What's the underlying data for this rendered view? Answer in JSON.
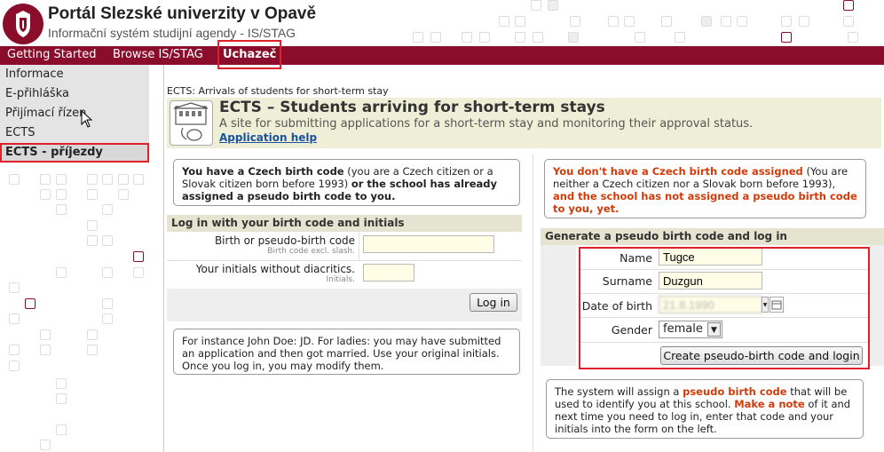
{
  "header": {
    "title": "Portál Slezské univerzity v Opavě",
    "subtitle": "Informační systém studijní agendy - IS/STAG"
  },
  "menubar": {
    "items": [
      "Getting Started",
      "Browse IS/STAG",
      "Uchazeč"
    ]
  },
  "sidebar": {
    "items": [
      "Informace",
      "E-přihláška",
      "Přijímací řízen",
      "ECTS",
      "ECTS - příjezdy"
    ],
    "active_index": 4
  },
  "breadcrumb": "ECTS: Arrivals of students for short-term stay",
  "banner": {
    "title": "ECTS – Students arriving for short-term stays",
    "description": "A site for submitting applications for a short-term stay and monitoring their approval status.",
    "help_link": "Application help"
  },
  "left": {
    "czech_box": {
      "bold1": "You have a Czech birth code",
      "normal": " (you are a Czech citizen or a Slovak citizen born before 1993) ",
      "bold2": "or the school has already assigned a pseudo birth code to you."
    },
    "login_title": "Log in with your birth code and initials",
    "birth_label": "Birth or pseudo-birth code",
    "birth_hint": "Birth code excl. slash.",
    "birth_value": "",
    "initials_label": "Your initials without diacritics.",
    "initials_hint": "Initials.",
    "initials_value": "",
    "login_button": "Log in",
    "johndoe_text": "For instance John Doe: JD. For ladies: you may have submitted an application and then got married. Use your original initials. Once you log in, you may modify them."
  },
  "right": {
    "nocode_box": {
      "red1": "You don't have a Czech birth code assigned",
      "normal": " (You are neither a Czech citizen nor a Slovak born before 1993), ",
      "red2": "and the school has not assigned a pseudo birth code to you, yet."
    },
    "gen_title": "Generate a pseudo birth code and log in",
    "name_label": "Name",
    "name_value": "Tugce",
    "surname_label": "Surname",
    "surname_value": "Duzgun",
    "dob_label": "Date of birth",
    "dob_value": "21.8.1990",
    "gender_label": "Gender",
    "gender_value": "female",
    "create_button": "Create pseudo-birth code and login",
    "system_box": {
      "t1": "The system will assign a ",
      "r1": "pseudo birth code",
      "t2": " that will be used to identify you at this school. ",
      "r2": "Make a note",
      "t3": " of it and next time you need to log in, enter that code and your initials into the form on the left."
    }
  },
  "colors": {
    "brand": "#8a0e2b",
    "highlight": "#e0202a",
    "warning_text": "#d23b0a",
    "link": "#1a52a0"
  }
}
